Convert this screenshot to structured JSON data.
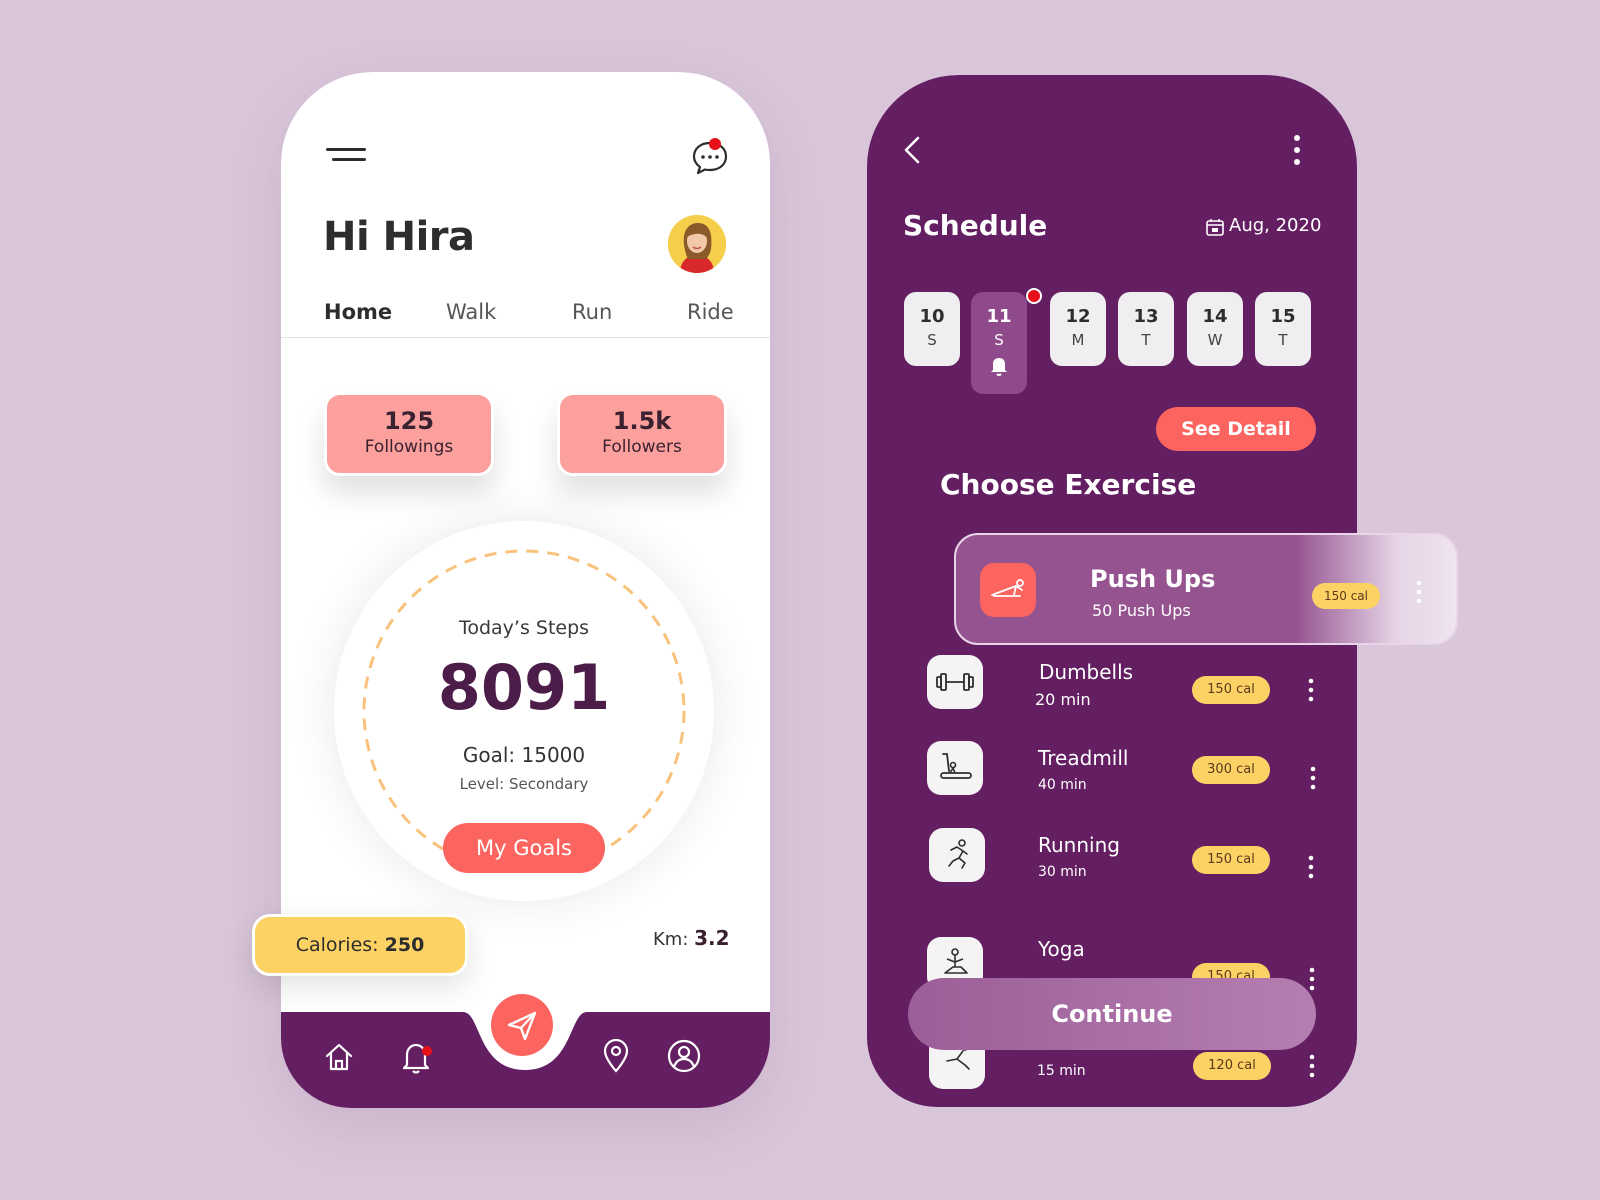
{
  "home": {
    "greeting": "Hi Hira",
    "tabs": [
      {
        "label": "Home",
        "active": true
      },
      {
        "label": "Walk",
        "active": false
      },
      {
        "label": "Run",
        "active": false
      },
      {
        "label": "Ride",
        "active": false
      }
    ],
    "stats": {
      "followings": {
        "value": "125",
        "label": "Followings"
      },
      "followers": {
        "value": "1.5k",
        "label": "Followers"
      }
    },
    "steps": {
      "title": "Today’s Steps",
      "value": "8091",
      "goal": "Goal: 15000",
      "level": "Level: Secondary"
    },
    "my_goals_label": "My Goals",
    "calories": {
      "label": "Calories:",
      "value": "250"
    },
    "km": {
      "label": "Km:",
      "value": "3.2"
    },
    "nav_icons": [
      "home-icon",
      "bell-icon",
      "send-icon",
      "location-pin-icon",
      "profile-icon"
    ]
  },
  "schedule": {
    "title": "Schedule",
    "date": "Aug, 2020",
    "days": [
      {
        "num": "10",
        "letter": "S",
        "active": false
      },
      {
        "num": "11",
        "letter": "S",
        "active": true
      },
      {
        "num": "12",
        "letter": "M",
        "active": false
      },
      {
        "num": "13",
        "letter": "T",
        "active": false
      },
      {
        "num": "14",
        "letter": "W",
        "active": false
      },
      {
        "num": "15",
        "letter": "T",
        "active": false
      }
    ],
    "see_detail_label": "See Detail",
    "choose_title": "Choose Exercise",
    "featured": {
      "name": "Push Ups",
      "sub": "50 Push Ups",
      "cal": "150 cal",
      "icon": "push-up-icon"
    },
    "exercises": [
      {
        "name": "Dumbells",
        "sub": "20 min",
        "cal": "150 cal",
        "icon": "dumbbell-icon"
      },
      {
        "name": "Treadmill",
        "sub": "40 min",
        "cal": "300 cal",
        "icon": "treadmill-icon"
      },
      {
        "name": "Running",
        "sub": "30 min",
        "cal": "150 cal",
        "icon": "running-icon"
      },
      {
        "name": "Yoga",
        "sub": "",
        "cal": "150 cal",
        "icon": "yoga-icon"
      },
      {
        "name": "",
        "sub": "15 min",
        "cal": "120 cal",
        "icon": "stretch-icon"
      }
    ],
    "continue_label": "Continue"
  },
  "colors": {
    "background": "#d9c6da",
    "purple": "#641f62",
    "coral": "#fb645f",
    "pink": "#fba09d",
    "yellow": "#fdd265"
  }
}
